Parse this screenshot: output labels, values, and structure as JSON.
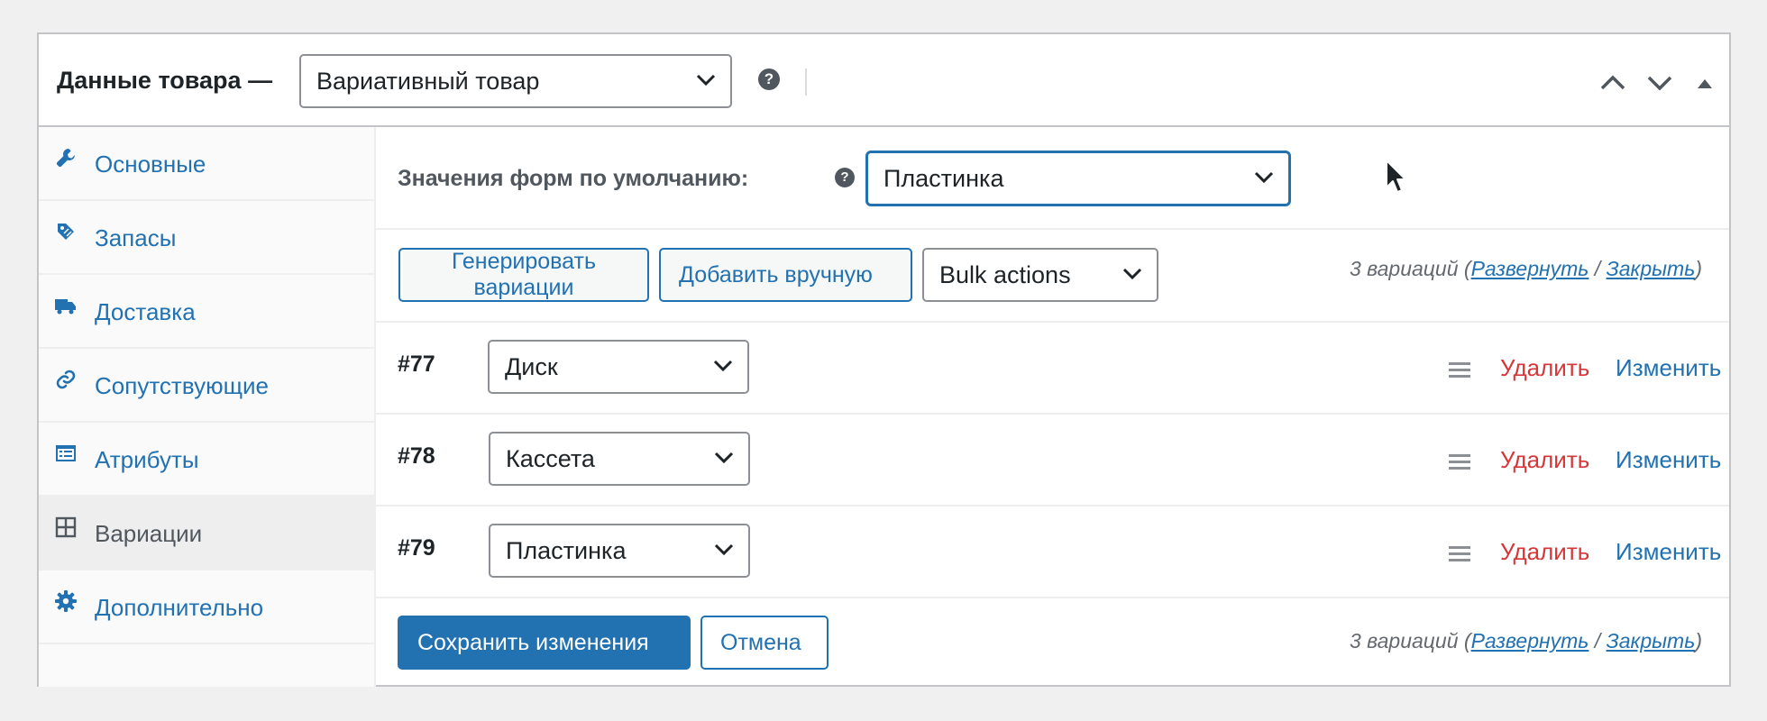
{
  "header": {
    "title": "Данные товара —",
    "product_type": "Вариативный товар",
    "help_glyph": "?"
  },
  "sidebar": {
    "items": [
      {
        "label": "Основные",
        "icon": "wrench-icon"
      },
      {
        "label": "Запасы",
        "icon": "tag-icon"
      },
      {
        "label": "Доставка",
        "icon": "truck-icon"
      },
      {
        "label": "Сопутствующие",
        "icon": "link-icon"
      },
      {
        "label": "Атрибуты",
        "icon": "list-icon"
      },
      {
        "label": "Вариации",
        "icon": "grid-icon",
        "active": true
      },
      {
        "label": "Дополнительно",
        "icon": "gear-icon"
      }
    ]
  },
  "defaults": {
    "label": "Значения форм по умолчанию:",
    "value": "Пластинка"
  },
  "toolbar": {
    "generate_label": "Генерировать вариации",
    "add_label": "Добавить вручную",
    "bulk_label": "Bulk actions"
  },
  "summary": {
    "count_text": "3 вариаций",
    "open_paren": "(",
    "expand": "Развернуть",
    "slash": "/",
    "collapse": "Закрыть",
    "close_paren": ")"
  },
  "variations": [
    {
      "id": "#77",
      "value": "Диск"
    },
    {
      "id": "#78",
      "value": "Кассета"
    },
    {
      "id": "#79",
      "value": "Пластинка"
    }
  ],
  "actions": {
    "delete_label": "Удалить",
    "edit_label": "Изменить"
  },
  "footer": {
    "save_label": "Сохранить изменения",
    "cancel_label": "Отмена"
  },
  "colors": {
    "accent": "#2271b1",
    "danger": "#d63638",
    "border": "#c3c4c7"
  }
}
